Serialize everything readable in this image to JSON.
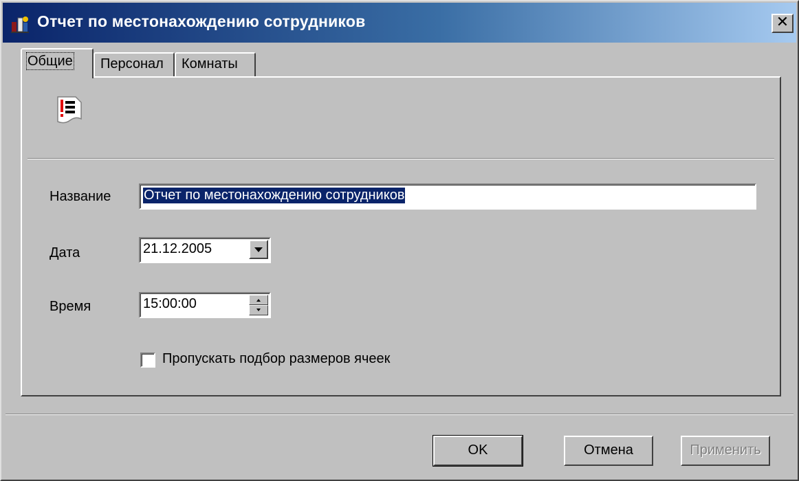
{
  "window": {
    "title": "Отчет по местонахождению сотрудников",
    "close_glyph": "✕"
  },
  "tabs": [
    {
      "label": "Общие",
      "active": true
    },
    {
      "label": "Персонал",
      "active": false
    },
    {
      "label": "Комнаты",
      "active": false
    }
  ],
  "form": {
    "name_label": "Название",
    "name_value": "Отчет по местонахождению сотрудников",
    "date_label": "Дата",
    "date_value": "21.12.2005",
    "time_label": "Время",
    "time_value": "15:00:00",
    "skip_cell_sizing_label": "Пропускать подбор размеров ячеек",
    "skip_cell_sizing_checked": false
  },
  "buttons": {
    "ok": "OK",
    "cancel": "Отмена",
    "apply": "Применить"
  },
  "icons": {
    "app": "employee-locator-icon",
    "report": "report-document-icon"
  },
  "colors": {
    "titlebar_start": "#0a246a",
    "titlebar_end": "#a6caf0",
    "face": "#c0c0c0",
    "selection": "#0a246a"
  }
}
